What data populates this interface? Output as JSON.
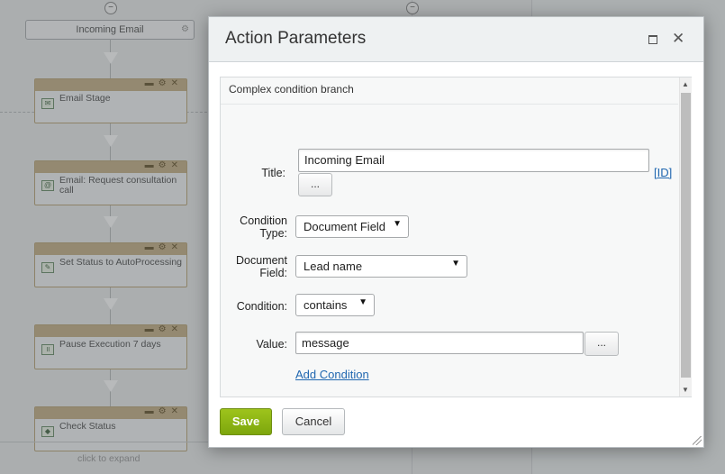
{
  "background": {
    "start_node": "Incoming Email",
    "blocks": [
      {
        "label": "Email Stage",
        "icon": "email-stage-icon"
      },
      {
        "label": "Email: Request consultation call",
        "icon": "email-icon"
      },
      {
        "label": "Set Status to AutoProcessing",
        "icon": "edit-icon"
      },
      {
        "label": "Pause Execution 7 days",
        "icon": "pause-icon"
      },
      {
        "label": "Check Status",
        "icon": "condition-icon"
      }
    ],
    "click_to_expand": "click to expand"
  },
  "dialog": {
    "title": "Action Parameters",
    "branch_label": "Complex condition branch",
    "fields": {
      "title_label": "Title:",
      "title_value": "Incoming Email",
      "id_link": "[ID]",
      "dots": "...",
      "condition_type_label_1": "Condition",
      "condition_type_label_2": "Type:",
      "condition_type_value": "Document Field",
      "document_field_label_1": "Document",
      "document_field_label_2": "Field:",
      "document_field_value": "Lead name",
      "condition_label": "Condition:",
      "condition_value": "contains",
      "value_label": "Value:",
      "value_value": "message",
      "add_condition": "Add Condition"
    },
    "buttons": {
      "save": "Save",
      "cancel": "Cancel"
    }
  },
  "colors": {
    "save_green": "#8db516",
    "link_blue": "#2067b0",
    "header_bg": "#eef1f2"
  }
}
